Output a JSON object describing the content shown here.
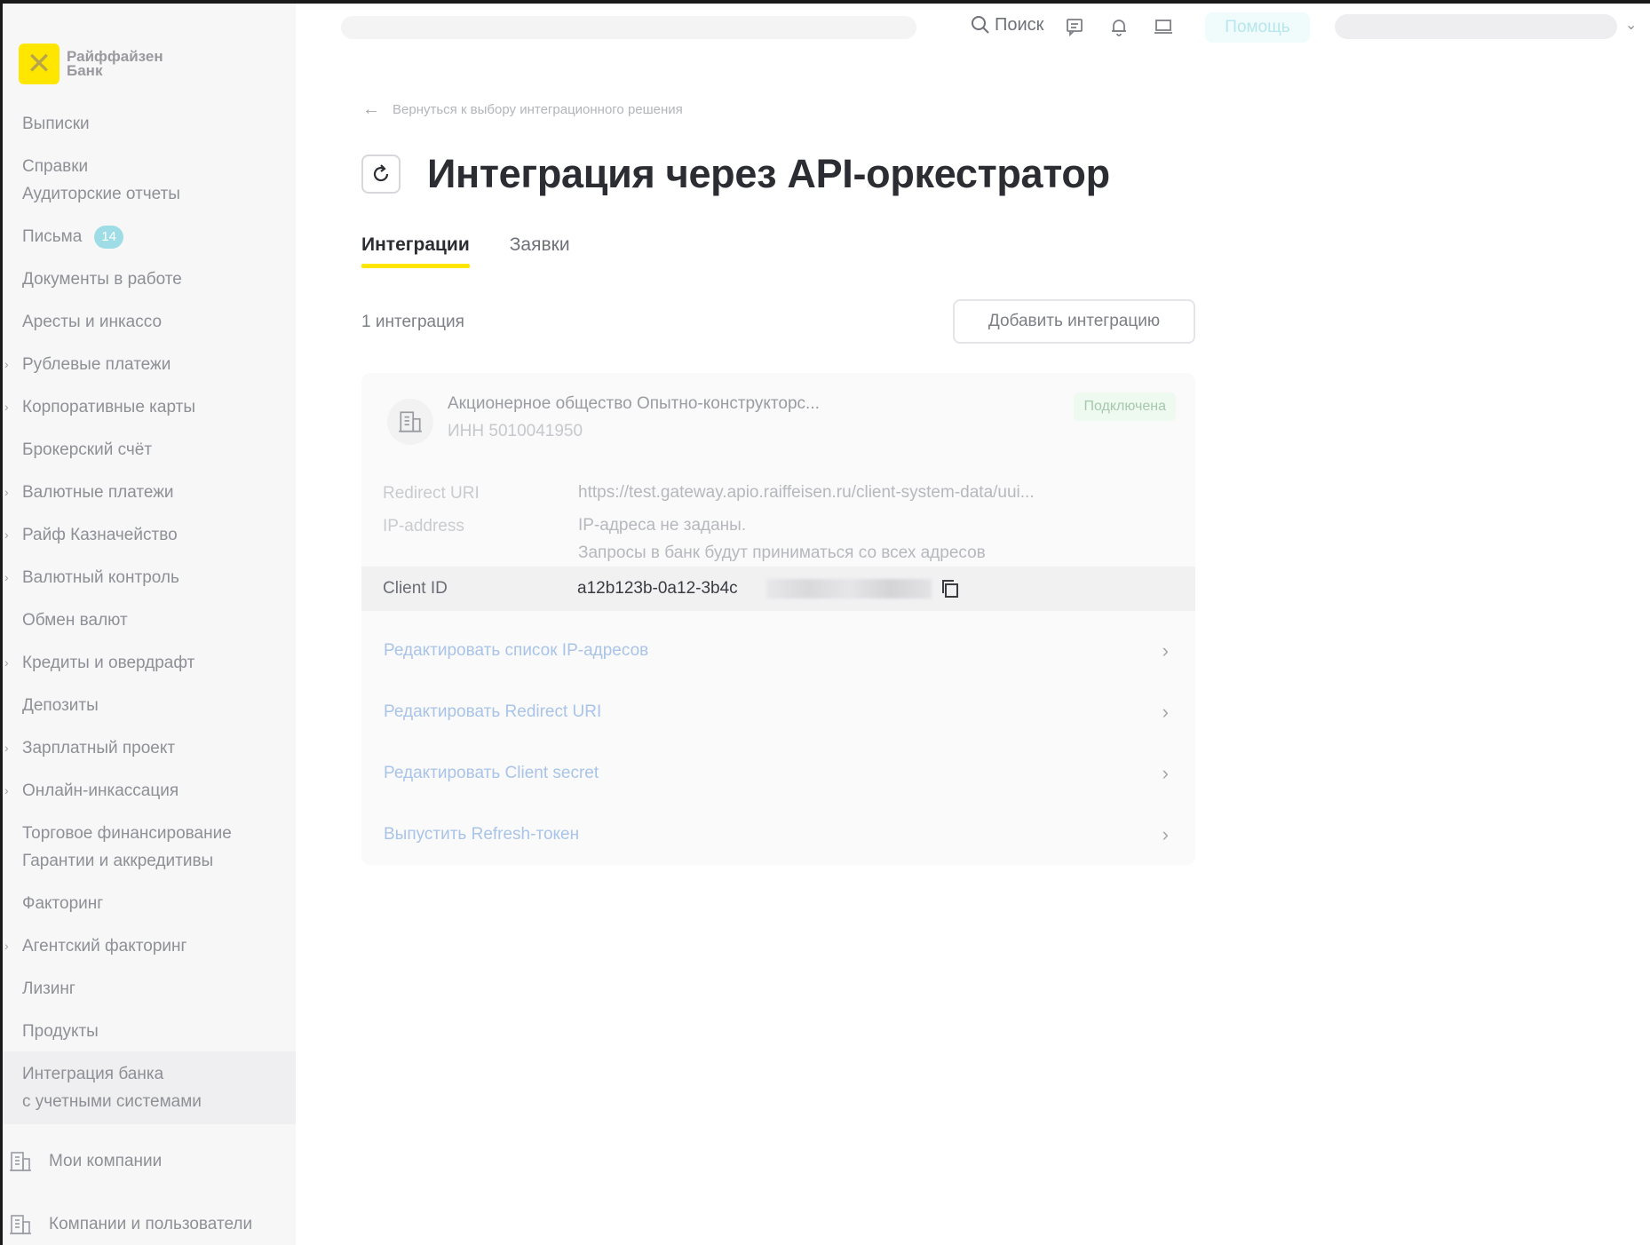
{
  "sidebar": {
    "logo_text_line1": "Райффайзен",
    "logo_text_line2": "Банк",
    "items": [
      {
        "label": "Выписки",
        "expandable": false
      },
      {
        "label": "Справки",
        "expandable": false
      },
      {
        "label": "Аудиторские отчеты",
        "expandable": false
      },
      {
        "label": "Письма",
        "expandable": false,
        "badge": "14"
      },
      {
        "label": "Документы в работе",
        "expandable": false
      },
      {
        "label": "Аресты и инкассо",
        "expandable": false
      },
      {
        "label": "Рублевые платежи",
        "expandable": true
      },
      {
        "label": "Корпоративные карты",
        "expandable": true
      },
      {
        "label": "Брокерский счёт",
        "expandable": false
      },
      {
        "label": "Валютные платежи",
        "expandable": true
      },
      {
        "label": "Райф Казначейство",
        "expandable": true
      },
      {
        "label": "Валютный контроль",
        "expandable": true
      },
      {
        "label": "Обмен валют",
        "expandable": false
      },
      {
        "label": "Кредиты и овердрафт",
        "expandable": true
      },
      {
        "label": "Депозиты",
        "expandable": false
      },
      {
        "label": "Зарплатный проект",
        "expandable": true
      },
      {
        "label": "Онлайн-инкассация",
        "expandable": true
      },
      {
        "label": "Торговое финансирование",
        "expandable": false
      },
      {
        "label": "Гарантии и аккредитивы",
        "expandable": false
      },
      {
        "label": "Факторинг",
        "expandable": false
      },
      {
        "label": "Агентский факторинг",
        "expandable": true
      },
      {
        "label": "Лизинг",
        "expandable": false
      },
      {
        "label": "Продукты",
        "expandable": false
      },
      {
        "label": "Интеграция банка",
        "expandable": false,
        "active": true
      },
      {
        "label": "с учетными системами",
        "expandable": false,
        "active": true
      }
    ],
    "bottom_items": [
      {
        "label": "Мои компании",
        "icon": "building-icon"
      },
      {
        "label": "Компании и пользователи",
        "icon": "building-icon"
      }
    ]
  },
  "header": {
    "search_label": "Поиск",
    "help_label": "Помощь",
    "icons": [
      "search-icon",
      "chat-icon",
      "bell-icon",
      "monitor-icon",
      "chevron-down-icon"
    ]
  },
  "main": {
    "back_link": "Вернуться к выбору интеграционного решения",
    "title": "Интеграция через API-оркестратор",
    "tabs": [
      {
        "label": "Интеграции",
        "active": true
      },
      {
        "label": "Заявки",
        "active": false
      }
    ],
    "count_label": "1 интеграция",
    "add_button": "Добавить интеграцию",
    "integration": {
      "org_name": "Акционерное общество Опытно-конструкторс...",
      "inn": "ИНН 5010041950",
      "status": "Подключена",
      "status_color": "#eef9ef",
      "redirect_label": "Redirect URI",
      "redirect_value": "https://test.gateway.apio.raiffeisen.ru/client-system-data/uui...",
      "ip_label": "IP-address",
      "ip_value_line1": "IP-адреса не заданы.",
      "ip_value_line2": "Запросы в банк будут приниматься со всех адресов",
      "client_id_label": "Client ID",
      "client_id_value": "a12b123b-0a12-3b4c",
      "actions": [
        "Редактировать список IP-адресов",
        "Редактировать Redirect URI",
        "Редактировать Client secret",
        "Выпустить Refresh-токен"
      ]
    }
  },
  "colors": {
    "accent": "#fee600",
    "link": "#a9c4e8",
    "badge": "#9fdde6"
  }
}
